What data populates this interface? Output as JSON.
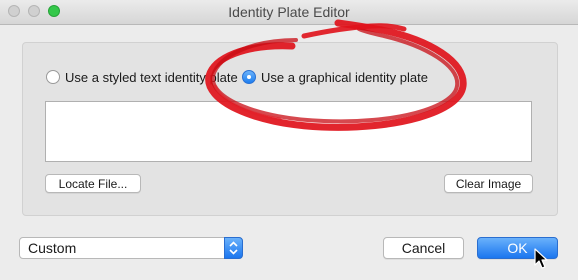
{
  "window": {
    "title": "Identity Plate Editor"
  },
  "options": {
    "styled_text_label": "Use a styled text identity plate",
    "graphical_label": "Use a graphical identity plate",
    "selected": "graphical"
  },
  "buttons": {
    "locate_file": "Locate File...",
    "clear_image": "Clear Image",
    "cancel": "Cancel",
    "ok": "OK"
  },
  "preset_select": {
    "value": "Custom"
  },
  "colors": {
    "accent": "#1b76ef",
    "annotation": "#e0121b",
    "zoom_button": "#34c84a"
  }
}
